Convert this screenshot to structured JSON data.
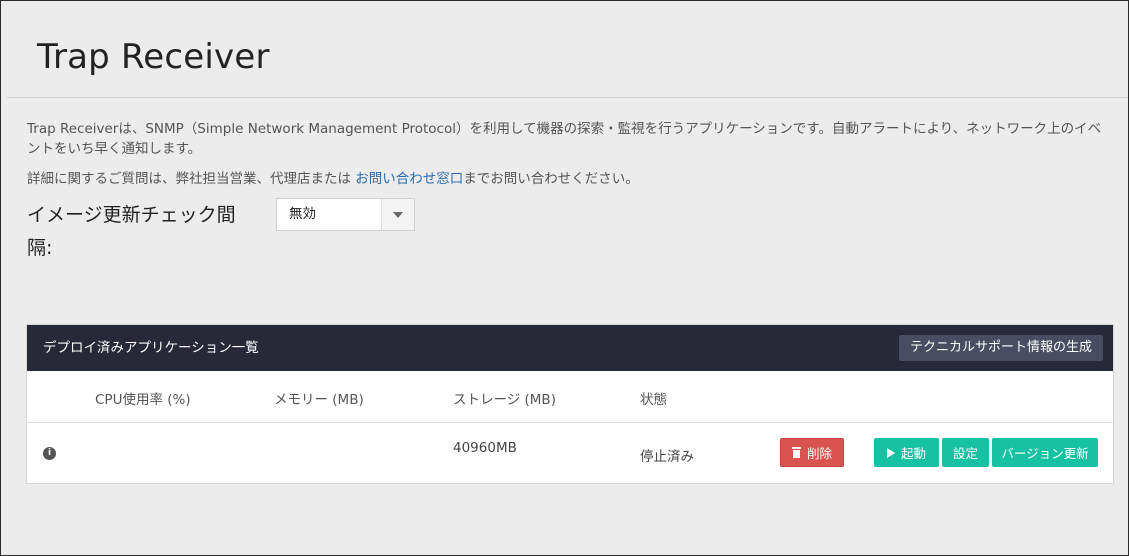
{
  "app": {
    "title": "Trap Receiver",
    "description": "Trap Receiverは、SNMP（Simple Network Management Protocol）を利用して機器の探索・監視を行うアプリケーションです。自動アラートにより、ネットワーク上のイベントをいち早く通知します。",
    "contact_prefix": "詳細に関するご質問は、弊社担当営業、代理店または ",
    "contact_link": "お問い合わせ窓口",
    "contact_suffix": "までお問い合わせください。"
  },
  "update_check": {
    "label": "イメージ更新チェック間隔:",
    "selected": "無効"
  },
  "panel": {
    "title": "デプロイ済みアプリケーション一覧",
    "support_button": "テクニカルサポート情報の生成",
    "columns": [
      "CPU使用率 (%)",
      "メモリー (MB)",
      "ストレージ (MB)",
      "状態"
    ],
    "rows": [
      {
        "cpu": "",
        "memory": "",
        "storage": "40960MB",
        "status": "停止済み",
        "delete_label": "削除",
        "start_label": "起動",
        "settings_label": "設定",
        "update_label": "バージョン更新"
      }
    ]
  },
  "colors": {
    "header_bg": "#272838",
    "accent_teal": "#17c1a3",
    "danger_red": "#d9534f",
    "link_blue": "#2a6db0"
  },
  "icons": {
    "info": "info-icon",
    "trash": "trash-icon",
    "play": "play-icon",
    "dropdown": "caret-down-icon"
  }
}
